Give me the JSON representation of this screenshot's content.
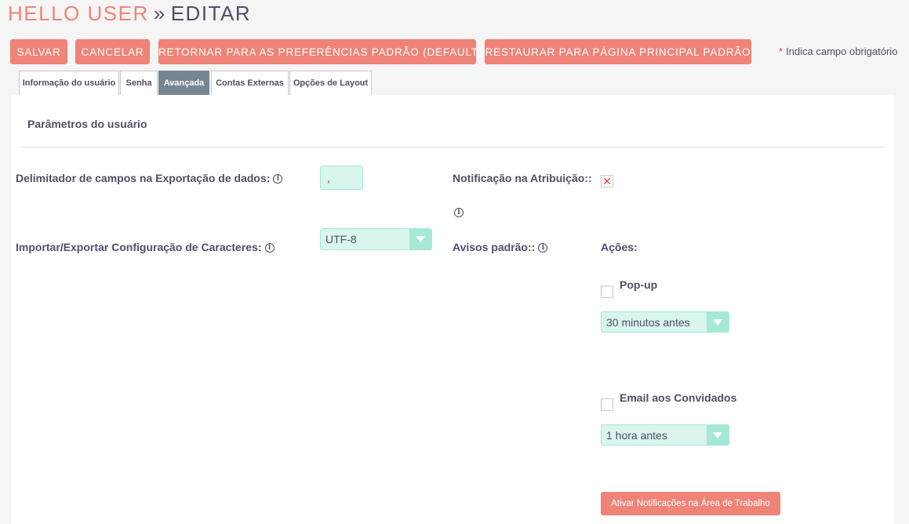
{
  "header": {
    "user_name": "HELLO USER",
    "separator": "»",
    "action": "EDITAR"
  },
  "toolbar": {
    "save": "SALVAR",
    "cancel": "CANCELAR",
    "reset_prefs": "RETORNAR PARA AS PREFERÊNCIAS PADRÃO (DEFAULT)",
    "reset_home": "RESTAURAR PARA PÁGINA PRINCIPAL PADRÃO",
    "required_star": "*",
    "required_note": "Indica campo obrigatório"
  },
  "tabs": [
    {
      "label": "Informação do usuário",
      "active": false
    },
    {
      "label": "Senha",
      "active": false
    },
    {
      "label": "Avançada",
      "active": true
    },
    {
      "label": "Contas Externas",
      "active": false
    },
    {
      "label": "Opções de Layout",
      "active": false
    }
  ],
  "section": {
    "title": "Parâmetros do usuário"
  },
  "fields": {
    "export_delimiter": {
      "label": "Delimitador de campos na Exportação de dados:",
      "value": ","
    },
    "charset": {
      "label": "Importar/Exportar Configuração de Caracteres:",
      "value": "UTF-8"
    },
    "assign_notification": {
      "label": "Notificação na Atribuição::",
      "checked": true
    },
    "default_reminders": {
      "label": "Avisos padrão::"
    },
    "actions": {
      "label": "Ações:",
      "popup": {
        "label": "Pop-up",
        "checked": false,
        "value": "30 minutos antes"
      },
      "email": {
        "label": "Email aos Convidados",
        "checked": false,
        "value": "1 hora antes"
      }
    },
    "desktop_notifications_button": "Ativar Notificações na Área de Trabalho"
  },
  "colors": {
    "accent": "#f08377",
    "tab_active": "#778591",
    "input_bg": "#d8f5ee",
    "input_border": "#a5e8d6",
    "text": "#534d64"
  },
  "icons": {
    "info": "info-icon",
    "check": "x-check-icon",
    "dropdown": "chevron-down-icon"
  }
}
